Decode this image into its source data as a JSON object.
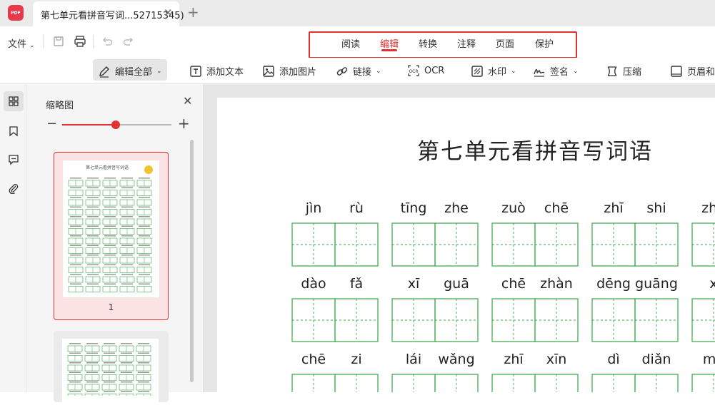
{
  "app": {
    "logo_text": "PDF"
  },
  "tab": {
    "title": "第七单元看拼音写词...52715345)",
    "close_label": "✕",
    "new_tab_label": "+"
  },
  "toolbar": {
    "file_label": "文件",
    "main_tabs": [
      "阅读",
      "编辑",
      "转换",
      "注释",
      "页面",
      "保护"
    ],
    "active_main_tab": "编辑",
    "tools": {
      "edit_all": "编辑全部",
      "add_text": "添加文本",
      "add_image": "添加图片",
      "link": "链接",
      "ocr": "OCR",
      "watermark": "水印",
      "sign": "签名",
      "compress": "压缩",
      "header_footer": "页眉和"
    }
  },
  "thumbnail_panel": {
    "title": "缩略图",
    "close_label": "✕",
    "zoom_minus": "−",
    "zoom_plus": "+",
    "zoom_level": 0.49,
    "page_numbers": [
      "1"
    ]
  },
  "document": {
    "title": "第七单元看拼音写词语",
    "rows": [
      [
        "jìn",
        "rù",
        "tīng",
        "zhe",
        "zuò",
        "chē",
        "zhī",
        "shi",
        "zhe"
      ],
      [
        "dào",
        "fǎ",
        "xī",
        "guā",
        "chē",
        "zhàn",
        "dēng",
        "guāng",
        "x"
      ],
      [
        "chē",
        "zi",
        "lái",
        "wǎng",
        "zhī",
        "xīn",
        "dì",
        "diǎn",
        "mó"
      ]
    ]
  },
  "colors": {
    "accent": "#e03030",
    "grid_green": "#3aa54a"
  }
}
